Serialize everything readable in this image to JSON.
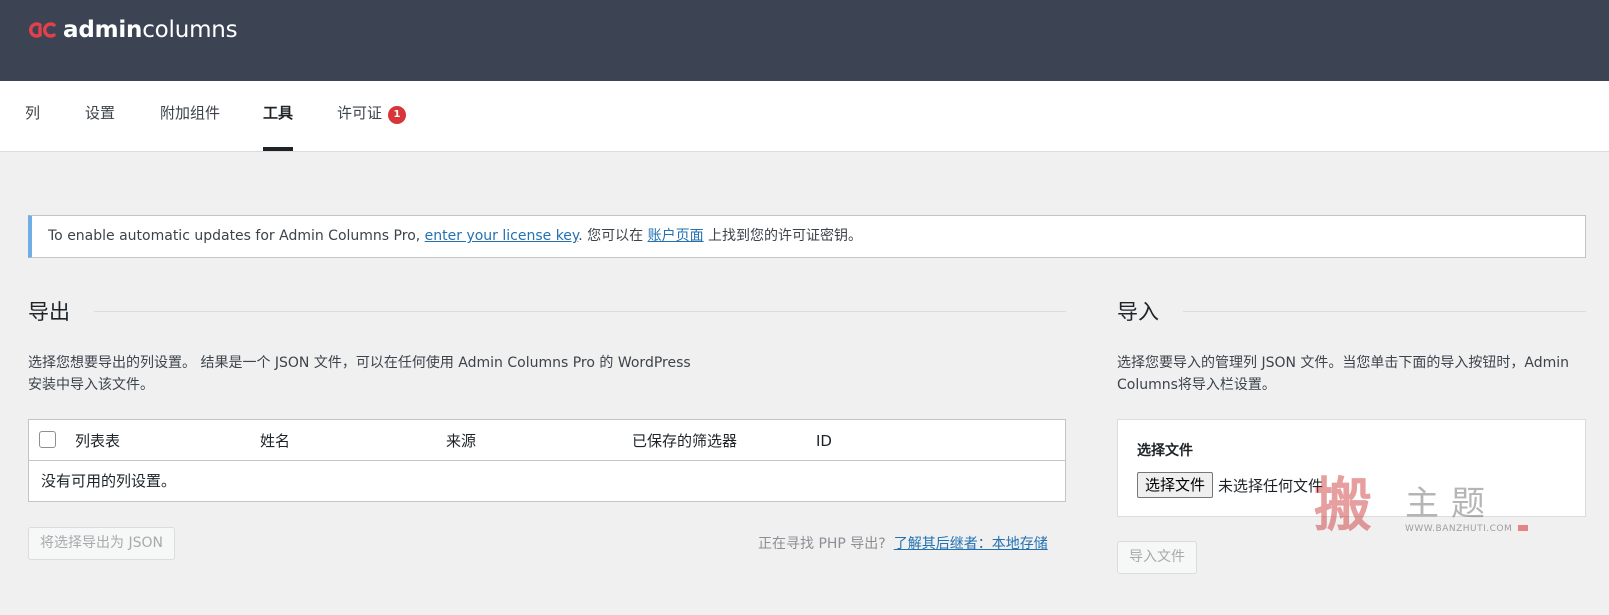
{
  "brand": {
    "name_bold": "admin",
    "name_rest": "columns",
    "accent": "#e2414b",
    "header_bg": "#3c4454"
  },
  "tabs": [
    {
      "label": "列"
    },
    {
      "label": "设置"
    },
    {
      "label": "附加组件"
    },
    {
      "label": "工具",
      "active": true
    },
    {
      "label": "许可证",
      "badge": "1"
    }
  ],
  "notice": {
    "text_before": "To enable automatic updates for Admin Columns Pro, ",
    "link1": "enter your license key",
    "text_middle": ". 您可以在 ",
    "link2": "账户页面",
    "text_after": " 上找到您的许可证密钥。"
  },
  "export": {
    "title": "导出",
    "desc_line1": "选择您想要导出的列设置。 结果是一个 JSON 文件，可以在任何使用 Admin Columns Pro 的 WordPress",
    "desc_line2": "安装中导入该文件。",
    "columns": [
      "列表表",
      "姓名",
      "来源",
      "已保存的筛选器",
      "ID"
    ],
    "empty_text": "没有可用的列设置。",
    "button": "将选择导出为 JSON",
    "php_text": "正在寻找 PHP 导出?",
    "php_link": "了解其后继者：本地存储"
  },
  "import": {
    "title": "导入",
    "desc_line1": "选择您要导入的管理列 JSON 文件。当您单击下面的导入按钮时，Admin",
    "desc_line2": "Columns将导入栏设置。",
    "file_label": "选择文件",
    "file_button": "选择文件",
    "file_status": "未选择任何文件",
    "button": "导入文件"
  },
  "watermark": {
    "seal": "搬",
    "chars": "主题",
    "url": "WWW.BANZHUTI.COM"
  }
}
